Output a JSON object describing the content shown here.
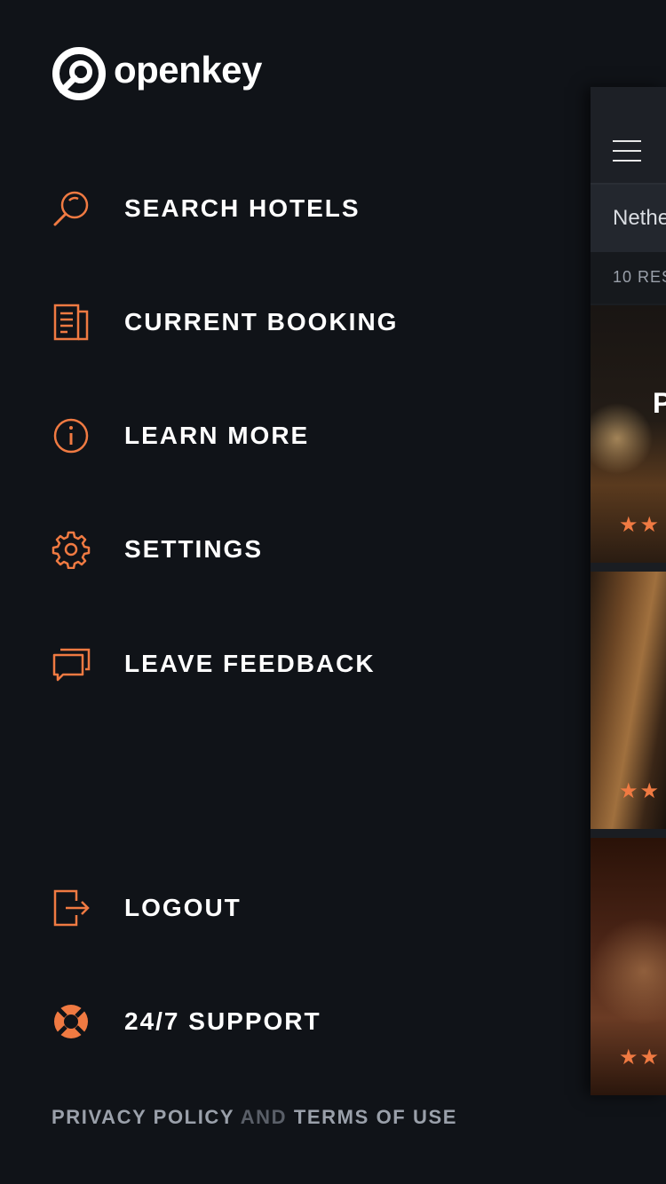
{
  "brand": {
    "name": "openkey",
    "accent_color": "#f07a42"
  },
  "menu": {
    "items": [
      {
        "label": "SEARCH HOTELS",
        "icon": "search-icon"
      },
      {
        "label": "CURRENT BOOKING",
        "icon": "booking-document-icon"
      },
      {
        "label": "LEARN MORE",
        "icon": "info-icon"
      },
      {
        "label": "SETTINGS",
        "icon": "gear-icon"
      },
      {
        "label": "LEAVE FEEDBACK",
        "icon": "chat-bubbles-icon"
      }
    ],
    "bottom_items": [
      {
        "label": "LOGOUT",
        "icon": "logout-icon"
      },
      {
        "label": "24/7 SUPPORT",
        "icon": "lifebuoy-icon"
      }
    ]
  },
  "footer": {
    "privacy_label": "PRIVACY POLICY",
    "and_label": "AND",
    "terms_label": "TERMS OF USE"
  },
  "background_screen": {
    "search_text": "Nethe",
    "results_text": "10 RES",
    "card_title_text": "P",
    "cards": [
      {
        "rating_stars_visible": 2
      },
      {
        "rating_stars_visible": 2
      },
      {
        "rating_stars_visible": 2
      }
    ]
  }
}
